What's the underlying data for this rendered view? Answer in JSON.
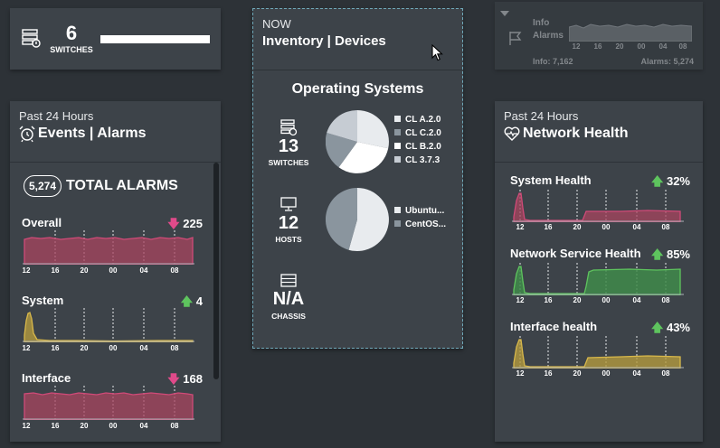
{
  "switches_card": {
    "count": "6",
    "label": "SWITCHES"
  },
  "info_alarms": {
    "title_line1": "Info",
    "title_line2": "Alarms",
    "ticks": [
      "12",
      "16",
      "20",
      "00",
      "04",
      "08"
    ],
    "info_text": "Info: 7,162",
    "alarms_text": "Alarms: 5,274"
  },
  "inventory": {
    "now": "NOW",
    "title": "Inventory | Devices",
    "os_title": "Operating Systems",
    "switches": {
      "count": "13",
      "label": "SWITCHES",
      "legend": [
        "CL A.2.0",
        "CL C.2.0",
        "CL B.2.0",
        "CL 3.7.3"
      ]
    },
    "hosts": {
      "count": "12",
      "label": "HOSTS",
      "legend": [
        "Ubuntu...",
        "CentOS..."
      ]
    },
    "chassis": {
      "count": "N/A",
      "label": "CHASSIS"
    }
  },
  "events": {
    "period": "Past 24 Hours",
    "title": "Events | Alarms",
    "total_count": "5,274",
    "total_label": "TOTAL ALARMS",
    "metrics": [
      {
        "name": "Overall",
        "value": "225",
        "trend": "down"
      },
      {
        "name": "System",
        "value": "4",
        "trend": "up"
      },
      {
        "name": "Interface",
        "value": "168",
        "trend": "down"
      }
    ],
    "ticks": [
      "12",
      "16",
      "20",
      "00",
      "04",
      "08"
    ]
  },
  "network": {
    "period": "Past 24 Hours",
    "title": "Network Health",
    "metrics": [
      {
        "name": "System Health",
        "value": "32%",
        "trend": "up"
      },
      {
        "name": "Network Service Health",
        "value": "85%",
        "trend": "up"
      },
      {
        "name": "Interface health",
        "value": "43%",
        "trend": "up"
      }
    ],
    "ticks": [
      "12",
      "16",
      "20",
      "00",
      "04",
      "08"
    ]
  },
  "icons": {
    "switch": "switch-icon",
    "alarm": "alarm-clock-icon",
    "heart": "heart-pulse-icon",
    "host": "monitor-icon",
    "chassis": "chassis-icon",
    "flag": "flag-icon",
    "caret": "caret-down-icon",
    "cursor": "mouse-pointer-icon"
  },
  "colors": {
    "background": "#2d3237",
    "card": "#3d4349",
    "alarm_pink": "#d04a78",
    "health_red": "#d04a78",
    "health_green": "#5ec45e",
    "health_yellow": "#d8b84a",
    "trend_up": "#5ec45e",
    "trend_down": "#e04a8a",
    "pie_slices": [
      "#e8ebee",
      "#8a959e",
      "#ffffff",
      "#c6ccd3"
    ]
  }
}
